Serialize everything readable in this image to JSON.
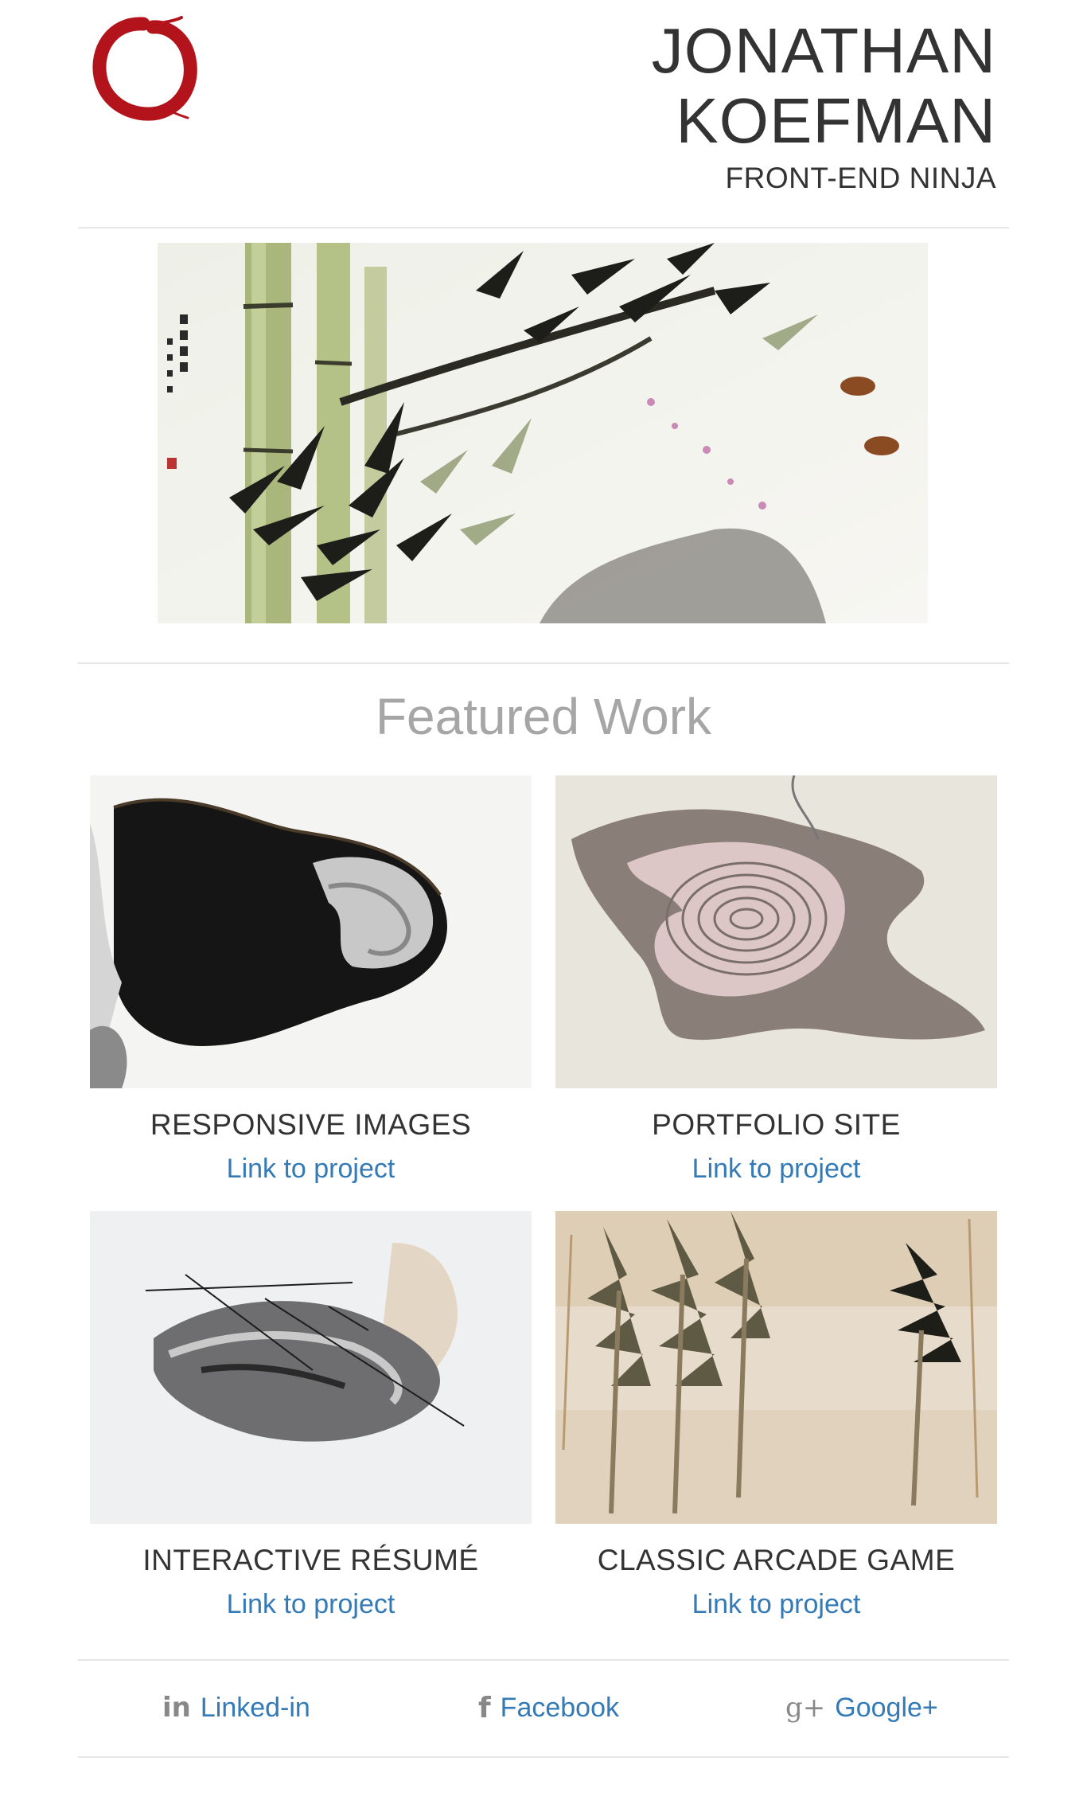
{
  "header": {
    "name_line1": "JONATHAN",
    "name_line2": "KOEFMAN",
    "subtitle": "FRONT-END NINJA",
    "logo_icon": "enso-circle-icon",
    "logo_color": "#b3141b"
  },
  "hero": {
    "image_icon": "bamboo-painting-image"
  },
  "featured": {
    "title": "Featured Work",
    "projects": [
      {
        "title": "RESPONSIVE IMAGES",
        "link_label": "Link to project",
        "image_icon": "ink-blot-painting-image"
      },
      {
        "title": "PORTFOLIO SITE",
        "link_label": "Link to project",
        "image_icon": "marbled-ink-painting-image"
      },
      {
        "title": "INTERACTIVE RÉSUMÉ",
        "link_label": "Link to project",
        "image_icon": "brush-stroke-painting-image"
      },
      {
        "title": "CLASSIC ARCADE GAME",
        "link_label": "Link to project",
        "image_icon": "forest-painting-image"
      }
    ]
  },
  "social": {
    "items": [
      {
        "label": "Linked-in",
        "icon": "linkedin-icon",
        "glyph": "in"
      },
      {
        "label": "Facebook",
        "icon": "facebook-icon",
        "glyph": "f"
      },
      {
        "label": "Google+",
        "icon": "google-plus-icon",
        "glyph": "g+"
      }
    ]
  },
  "colors": {
    "link": "#337ab7",
    "text": "#333333",
    "muted_title": "#a6a6a6",
    "divider": "#e6e6e6"
  }
}
